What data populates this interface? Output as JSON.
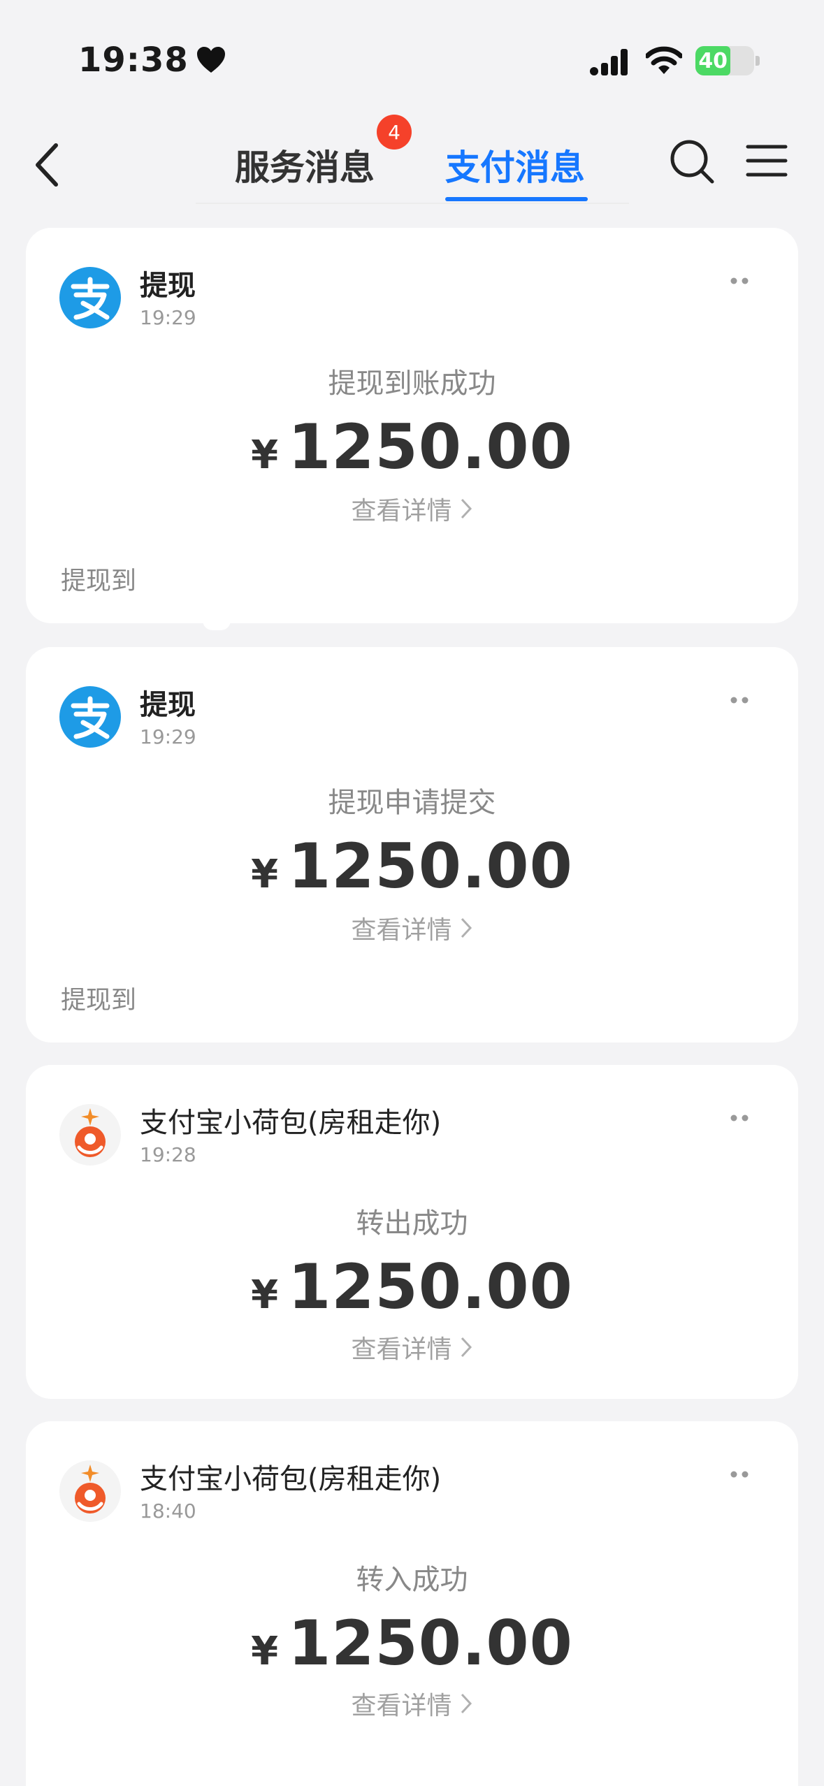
{
  "status_bar": {
    "time": "19:38",
    "battery": "40"
  },
  "header": {
    "tabs": [
      {
        "label": "服务消息",
        "badge": "4",
        "active": false
      },
      {
        "label": "支付消息",
        "active": true
      }
    ],
    "accent_color": "#1677ff",
    "badge_color": "#f5412a"
  },
  "cards": [
    {
      "title": "提现",
      "time": "19:29",
      "status": "提现到账成功",
      "currency": "¥",
      "amount": "1250.00",
      "detail_label": "查看详情",
      "note": "提现到",
      "icon": "alipay-icon"
    },
    {
      "title": "提现",
      "time": "19:29",
      "status": "提现申请提交",
      "currency": "¥",
      "amount": "1250.00",
      "detail_label": "查看详情",
      "note": "提现到",
      "icon": "alipay-icon"
    },
    {
      "title": "支付宝小荷包(房租走你)",
      "time": "19:28",
      "status": "转出成功",
      "currency": "¥",
      "amount": "1250.00",
      "detail_label": "查看详情",
      "icon": "pouch-icon"
    },
    {
      "title": "支付宝小荷包(房租走你)",
      "time": "18:40",
      "status": "转入成功",
      "currency": "¥",
      "amount": "1250.00",
      "detail_label": "查看详情",
      "icon": "pouch-icon"
    }
  ]
}
